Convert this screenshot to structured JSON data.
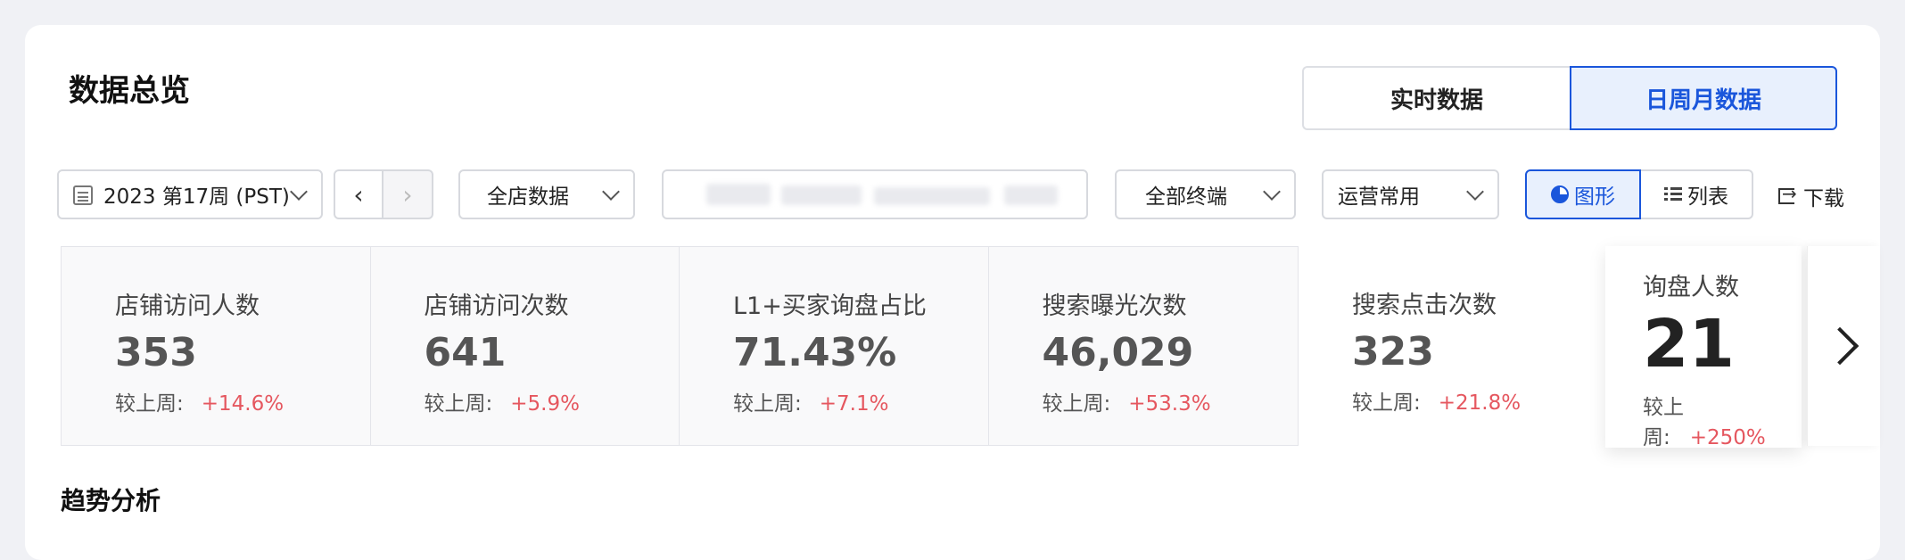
{
  "page": {
    "title": "数据总览",
    "section_title": "趋势分析"
  },
  "view_toggle": {
    "realtime": "实时数据",
    "daily": "日周月数据",
    "selected": "daily"
  },
  "filters": {
    "date": "2023 第17周 (PST)",
    "store": "全店数据",
    "search_value": "",
    "terminal": "全部终端",
    "ops": "运营常用"
  },
  "display_toggle": {
    "chart": "图形",
    "list": "列表",
    "selected": "chart"
  },
  "download_label": "下载",
  "compare_label": "较上周:",
  "metrics": [
    {
      "label": "店铺访问人数",
      "value": "353",
      "change": "+14.6%"
    },
    {
      "label": "店铺访问次数",
      "value": "641",
      "change": "+5.9%"
    },
    {
      "label": "L1+买家询盘占比",
      "value": "71.43%",
      "change": "+7.1%"
    },
    {
      "label": "搜索曝光次数",
      "value": "46,029",
      "change": "+53.3%"
    },
    {
      "label": "搜索点击次数",
      "value": "323",
      "change": "+21.8%"
    }
  ],
  "active_metric": {
    "label": "询盘人数",
    "value": "21",
    "change": "+250%"
  },
  "colors": {
    "accent": "#1a56db",
    "increase": "#e5575f"
  }
}
